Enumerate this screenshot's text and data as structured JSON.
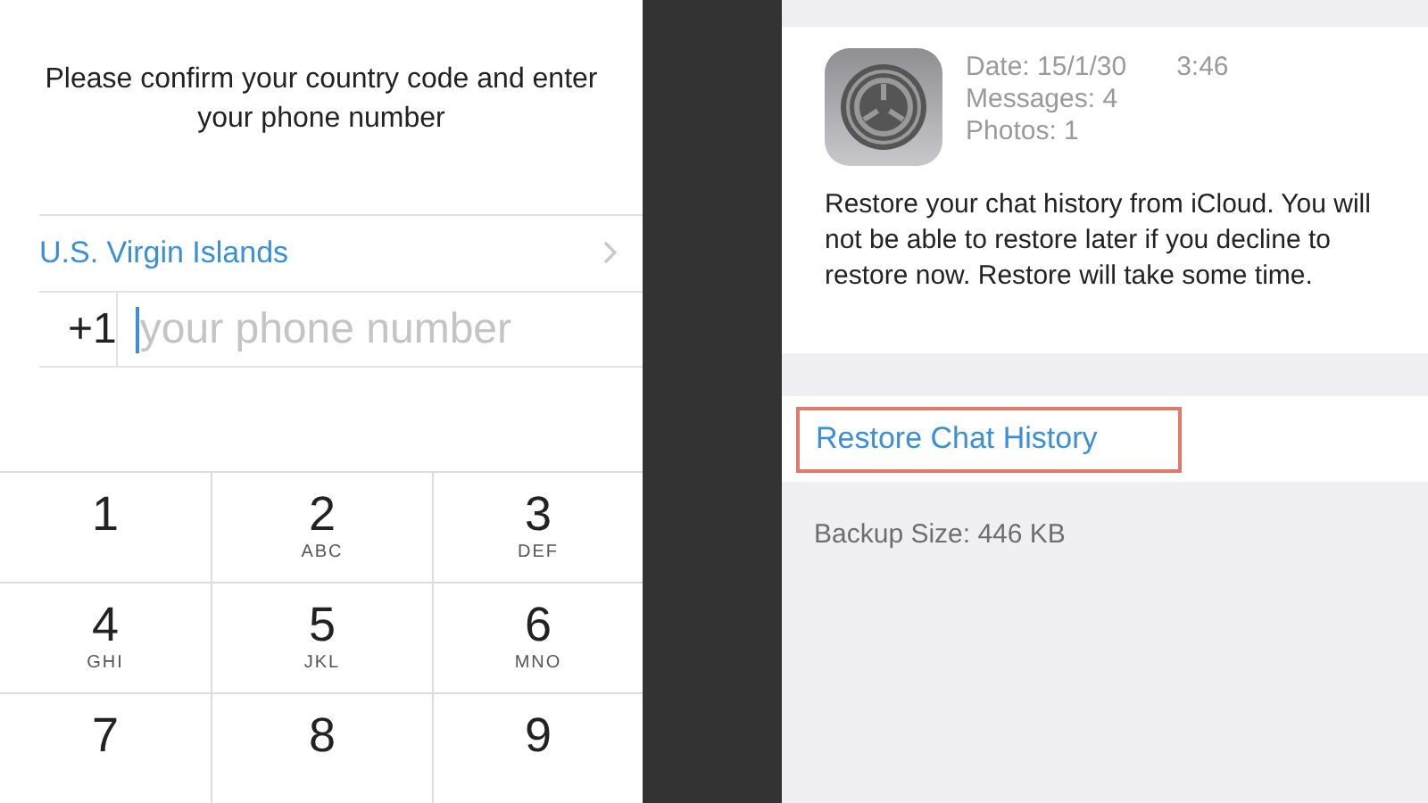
{
  "phone_setup": {
    "prompt": "Please confirm your country code and enter your phone number",
    "country": "U.S. Virgin Islands",
    "country_code": "+1",
    "phone_field": {
      "placeholder": "your phone number"
    },
    "keypad": [
      {
        "digit": "1"
      },
      {
        "digit": "2",
        "letters": "ABC"
      },
      {
        "digit": "3",
        "letters": "DEF"
      },
      {
        "digit": "4",
        "letters": "GHI"
      },
      {
        "digit": "5",
        "letters": "JKL"
      },
      {
        "digit": "6",
        "letters": "MNO"
      },
      {
        "digit": "7"
      },
      {
        "digit": "8"
      },
      {
        "digit": "9"
      }
    ]
  },
  "restore_screen": {
    "date": "Date: 15/1/30",
    "time": "3:46",
    "messages": "Messages: 4",
    "photos": "Photos: 1",
    "description": "Restore your chat history from iCloud. You will not be able to restore later if you decline to restore now. Restore will take some time.",
    "restore_button": {
      "label": "Restore Chat History",
      "highlighted": true
    },
    "backup_size": "Backup Size: 446 KB"
  }
}
